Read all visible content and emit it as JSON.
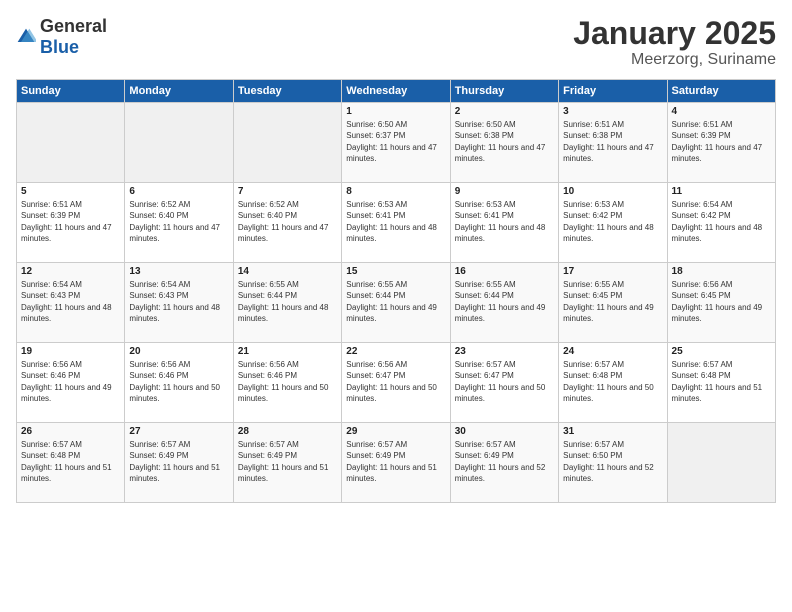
{
  "logo": {
    "general": "General",
    "blue": "Blue"
  },
  "title": "January 2025",
  "subtitle": "Meerzorg, Suriname",
  "days_of_week": [
    "Sunday",
    "Monday",
    "Tuesday",
    "Wednesday",
    "Thursday",
    "Friday",
    "Saturday"
  ],
  "weeks": [
    [
      {
        "day": "",
        "info": ""
      },
      {
        "day": "",
        "info": ""
      },
      {
        "day": "",
        "info": ""
      },
      {
        "day": "1",
        "info": "Sunrise: 6:50 AM\nSunset: 6:37 PM\nDaylight: 11 hours and 47 minutes."
      },
      {
        "day": "2",
        "info": "Sunrise: 6:50 AM\nSunset: 6:38 PM\nDaylight: 11 hours and 47 minutes."
      },
      {
        "day": "3",
        "info": "Sunrise: 6:51 AM\nSunset: 6:38 PM\nDaylight: 11 hours and 47 minutes."
      },
      {
        "day": "4",
        "info": "Sunrise: 6:51 AM\nSunset: 6:39 PM\nDaylight: 11 hours and 47 minutes."
      }
    ],
    [
      {
        "day": "5",
        "info": "Sunrise: 6:51 AM\nSunset: 6:39 PM\nDaylight: 11 hours and 47 minutes."
      },
      {
        "day": "6",
        "info": "Sunrise: 6:52 AM\nSunset: 6:40 PM\nDaylight: 11 hours and 47 minutes."
      },
      {
        "day": "7",
        "info": "Sunrise: 6:52 AM\nSunset: 6:40 PM\nDaylight: 11 hours and 47 minutes."
      },
      {
        "day": "8",
        "info": "Sunrise: 6:53 AM\nSunset: 6:41 PM\nDaylight: 11 hours and 48 minutes."
      },
      {
        "day": "9",
        "info": "Sunrise: 6:53 AM\nSunset: 6:41 PM\nDaylight: 11 hours and 48 minutes."
      },
      {
        "day": "10",
        "info": "Sunrise: 6:53 AM\nSunset: 6:42 PM\nDaylight: 11 hours and 48 minutes."
      },
      {
        "day": "11",
        "info": "Sunrise: 6:54 AM\nSunset: 6:42 PM\nDaylight: 11 hours and 48 minutes."
      }
    ],
    [
      {
        "day": "12",
        "info": "Sunrise: 6:54 AM\nSunset: 6:43 PM\nDaylight: 11 hours and 48 minutes."
      },
      {
        "day": "13",
        "info": "Sunrise: 6:54 AM\nSunset: 6:43 PM\nDaylight: 11 hours and 48 minutes."
      },
      {
        "day": "14",
        "info": "Sunrise: 6:55 AM\nSunset: 6:44 PM\nDaylight: 11 hours and 48 minutes."
      },
      {
        "day": "15",
        "info": "Sunrise: 6:55 AM\nSunset: 6:44 PM\nDaylight: 11 hours and 49 minutes."
      },
      {
        "day": "16",
        "info": "Sunrise: 6:55 AM\nSunset: 6:44 PM\nDaylight: 11 hours and 49 minutes."
      },
      {
        "day": "17",
        "info": "Sunrise: 6:55 AM\nSunset: 6:45 PM\nDaylight: 11 hours and 49 minutes."
      },
      {
        "day": "18",
        "info": "Sunrise: 6:56 AM\nSunset: 6:45 PM\nDaylight: 11 hours and 49 minutes."
      }
    ],
    [
      {
        "day": "19",
        "info": "Sunrise: 6:56 AM\nSunset: 6:46 PM\nDaylight: 11 hours and 49 minutes."
      },
      {
        "day": "20",
        "info": "Sunrise: 6:56 AM\nSunset: 6:46 PM\nDaylight: 11 hours and 50 minutes."
      },
      {
        "day": "21",
        "info": "Sunrise: 6:56 AM\nSunset: 6:46 PM\nDaylight: 11 hours and 50 minutes."
      },
      {
        "day": "22",
        "info": "Sunrise: 6:56 AM\nSunset: 6:47 PM\nDaylight: 11 hours and 50 minutes."
      },
      {
        "day": "23",
        "info": "Sunrise: 6:57 AM\nSunset: 6:47 PM\nDaylight: 11 hours and 50 minutes."
      },
      {
        "day": "24",
        "info": "Sunrise: 6:57 AM\nSunset: 6:48 PM\nDaylight: 11 hours and 50 minutes."
      },
      {
        "day": "25",
        "info": "Sunrise: 6:57 AM\nSunset: 6:48 PM\nDaylight: 11 hours and 51 minutes."
      }
    ],
    [
      {
        "day": "26",
        "info": "Sunrise: 6:57 AM\nSunset: 6:48 PM\nDaylight: 11 hours and 51 minutes."
      },
      {
        "day": "27",
        "info": "Sunrise: 6:57 AM\nSunset: 6:49 PM\nDaylight: 11 hours and 51 minutes."
      },
      {
        "day": "28",
        "info": "Sunrise: 6:57 AM\nSunset: 6:49 PM\nDaylight: 11 hours and 51 minutes."
      },
      {
        "day": "29",
        "info": "Sunrise: 6:57 AM\nSunset: 6:49 PM\nDaylight: 11 hours and 51 minutes."
      },
      {
        "day": "30",
        "info": "Sunrise: 6:57 AM\nSunset: 6:49 PM\nDaylight: 11 hours and 52 minutes."
      },
      {
        "day": "31",
        "info": "Sunrise: 6:57 AM\nSunset: 6:50 PM\nDaylight: 11 hours and 52 minutes."
      },
      {
        "day": "",
        "info": ""
      }
    ]
  ]
}
